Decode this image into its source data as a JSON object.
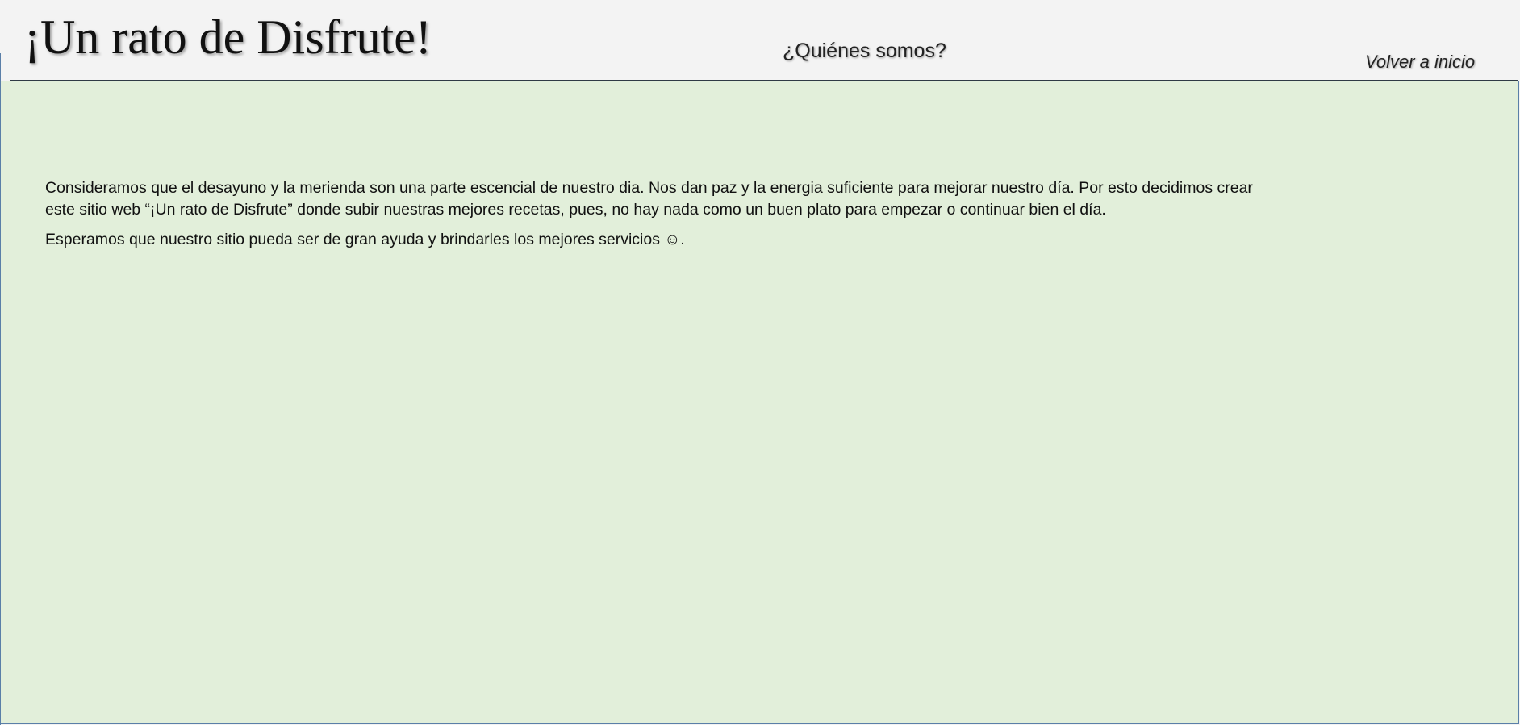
{
  "header": {
    "title": "¡Un rato de Disfrute!",
    "nav": {
      "about": "¿Quiénes somos?",
      "home": "Volver a inicio"
    }
  },
  "main": {
    "paragraphs": [
      "Consideramos que el desayuno y la merienda son una parte escencial de nuestro dia. Nos dan paz y la energia suficiente para mejorar nuestro día. Por esto decidimos crear este sitio web “¡Un rato de Disfrute” donde subir nuestras mejores recetas, pues, no hay nada como un buen plato para empezar o continuar bien el día.",
      "Esperamos que nuestro sitio pueda ser de gran ayuda y brindarles los mejores servicios ☺."
    ]
  },
  "colors": {
    "header_background": "#f3f3f3",
    "content_background": "#e2efda",
    "border": "#5a7fa8",
    "rule": "#2f3a45"
  }
}
